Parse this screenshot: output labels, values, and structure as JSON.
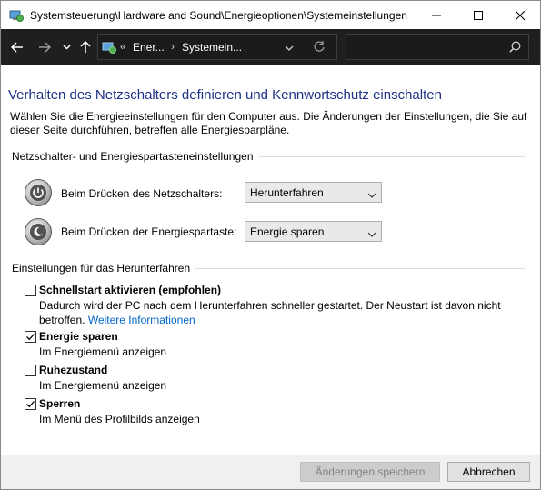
{
  "window": {
    "title": "Systemsteuerung\\Hardware and Sound\\Energieoptionen\\Systemeinstellungen",
    "controls": [
      "minimize-icon",
      "maximize-icon",
      "close-icon"
    ]
  },
  "address_bar": {
    "overflow": "«",
    "crumbs": [
      "Ener...",
      "Systemein..."
    ],
    "separator": "›",
    "search_placeholder": ""
  },
  "page": {
    "heading": "Verhalten des Netzschalters definieren und Kennwortschutz einschalten",
    "intro": "Wählen Sie die Energieeinstellungen für den Computer aus. Die Änderungen der Einstellungen, die Sie auf dieser Seite durchführen, betreffen alle Energiesparpläne."
  },
  "power_buttons": {
    "section_title": "Netzschalter- und Energiespartasteneinstellungen",
    "rows": [
      {
        "label": "Beim Drücken des Netzschalters:",
        "value": "Herunterfahren",
        "icon": "power-button-icon"
      },
      {
        "label": "Beim Drücken der Energiespartaste:",
        "value": "Energie sparen",
        "icon": "sleep-button-icon"
      }
    ]
  },
  "shutdown": {
    "section_title": "Einstellungen für das Herunterfahren",
    "options": [
      {
        "title": "Schnellstart aktivieren (empfohlen)",
        "checked": false,
        "desc": "Dadurch wird der PC nach dem Herunterfahren schneller gestartet. Der Neustart ist davon nicht betroffen.",
        "link": "Weitere Informationen"
      },
      {
        "title": "Energie sparen",
        "checked": true,
        "desc": "Im Energiemenü anzeigen"
      },
      {
        "title": "Ruhezustand",
        "checked": false,
        "desc": "Im Energiemenü anzeigen"
      },
      {
        "title": "Sperren",
        "checked": true,
        "desc": "Im Menü des Profilbilds anzeigen"
      }
    ]
  },
  "footer": {
    "save_label": "Änderungen speichern",
    "cancel_label": "Abbrechen"
  }
}
